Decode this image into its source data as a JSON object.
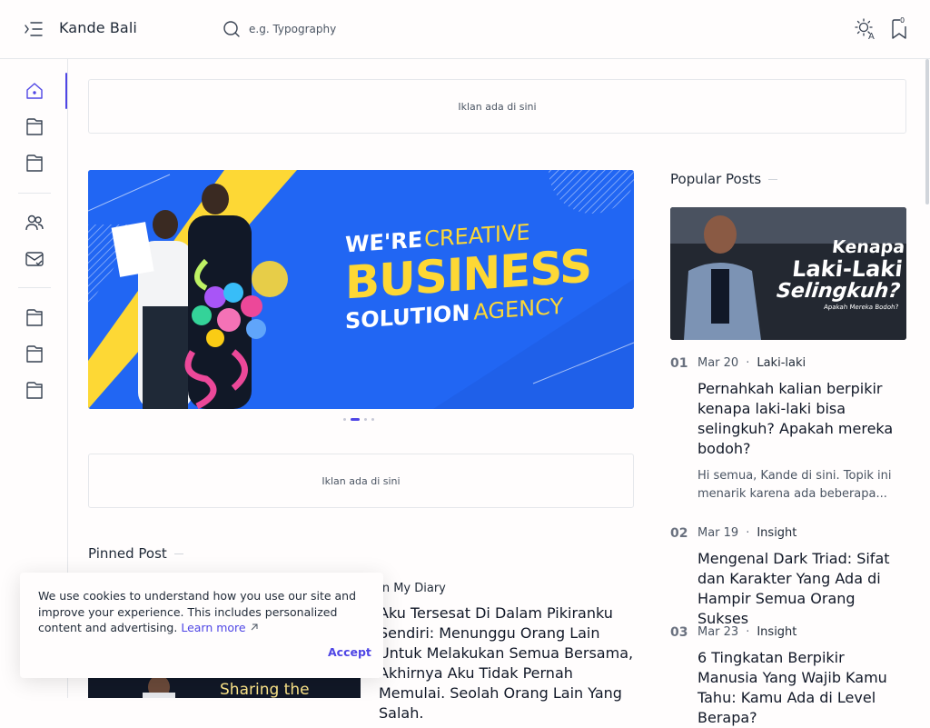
{
  "header": {
    "brand": "Kande Bali",
    "search_placeholder": "e.g. Typography",
    "bookmark_count": "0"
  },
  "sidebar": {
    "icons": [
      "home-icon",
      "folder-icon",
      "folder-icon",
      "users-icon",
      "mail-check-icon",
      "folder-icon",
      "folder-icon",
      "folder-icon"
    ]
  },
  "ads": {
    "top": "Iklan ada di sini",
    "middle": "Iklan ada di sini"
  },
  "hero": {
    "line1a": "WE'RE",
    "line1b": "CREATIVE",
    "line2": "BUSINESS",
    "line3a": "SOLUTION",
    "line3b": "AGENCY",
    "slides": 4,
    "active_slide": 1
  },
  "pinned": {
    "title": "Pinned Post",
    "category": "In My Diary",
    "post_title": "Aku Tersesat Di Dalam Pikiranku Sendiri: Menunggu Orang Lain Untuk Melakukan Semua Bersama, Akhirnya Aku Tidak Pernah Memulai. Seolah Orang Lain Yang Salah.",
    "thumb_text": "Sharing the"
  },
  "popular": {
    "title": "Popular Posts",
    "thumb_text_1": "Kenapa",
    "thumb_text_2": "Laki-Laki",
    "thumb_text_3": "Selingkuh?",
    "thumb_text_4": "Apakah Mereka Bodoh?",
    "posts": [
      {
        "num": "01",
        "date": "Mar 20",
        "category": "Laki-laki",
        "title": "Pernahkah kalian berpikir kenapa laki-laki bisa selingkuh? Apakah mereka bodoh?",
        "excerpt": "Hi semua, Kande di sini. Topik ini menarik karena ada beberapa..."
      },
      {
        "num": "02",
        "date": "Mar 19",
        "category": "Insight",
        "title": "Mengenal Dark Triad: Sifat dan Karakter Yang Ada di Hampir Semua Orang Sukses"
      },
      {
        "num": "03",
        "date": "Mar 23",
        "category": "Insight",
        "title": "6 Tingkatan Berpikir Manusia Yang Wajib Kamu Tahu: Kamu Ada di Level Berapa?"
      }
    ]
  },
  "cookie": {
    "text": "We use cookies to understand how you use our site and improve your experience. This includes personalized content and advertising.",
    "learn_more": "Learn more",
    "accept": "Accept"
  },
  "colors": {
    "accent": "#4f46e5",
    "hero_blue": "#2166f3",
    "hero_yellow": "#fdd835"
  }
}
